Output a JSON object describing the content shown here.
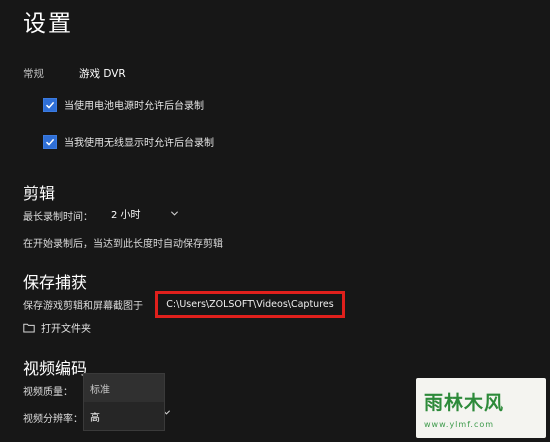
{
  "header": {
    "title": "设置"
  },
  "tabs": [
    {
      "label": "常规"
    },
    {
      "label": "游戏 DVR"
    }
  ],
  "checkboxes": [
    {
      "label": "当使用电池电源时允许后台录制",
      "checked": true
    },
    {
      "label": "当我使用无线显示时允许后台录制",
      "checked": true
    }
  ],
  "clips": {
    "title": "剪辑",
    "max_length_label": "最长录制时间：",
    "max_length_value": "2 小时",
    "description": "在开始录制后，当达到此长度时自动保存剪辑"
  },
  "captures": {
    "title": "保存捕获",
    "save_label": "保存游戏剪辑和屏幕截图于",
    "path": "C:\\Users\\ZOLSOFT\\Videos\\Captures",
    "open_folder": "打开文件夹"
  },
  "video_encoding": {
    "title": "视频编码",
    "quality_label": "视频质量：",
    "resolution_label": "视频分辨率：",
    "options": [
      "标准",
      "高"
    ]
  },
  "watermark": {
    "brand": "雨林木风",
    "url": "www.ylmf.com"
  },
  "colors": {
    "background": "#171717",
    "accent": "#2f6fd6",
    "highlight_border": "#e0201c"
  }
}
